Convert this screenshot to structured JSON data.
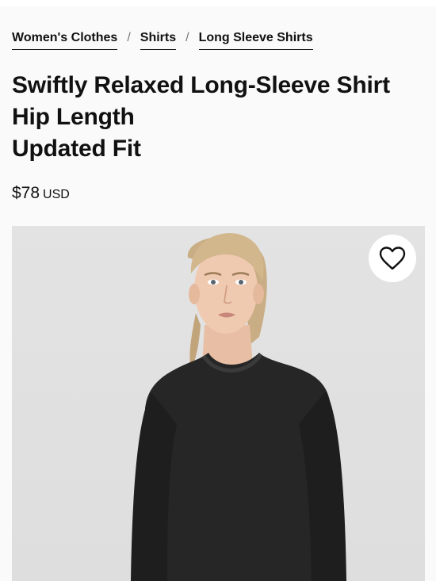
{
  "breadcrumb": {
    "items": [
      {
        "label": "Women's Clothes"
      },
      {
        "label": "Shirts"
      },
      {
        "label": "Long Sleeve Shirts"
      }
    ],
    "separator": "/"
  },
  "product": {
    "title_lines": [
      "Swiftly Relaxed Long-Sleeve Shirt",
      "Hip Length",
      "Updated Fit"
    ],
    "price": "$78",
    "currency": "USD"
  },
  "icons": {
    "wishlist": "heart-icon"
  },
  "colors": {
    "background": "#fafafa",
    "text": "#111111",
    "image_background": "#e0e0e0",
    "shirt": "#262626"
  }
}
